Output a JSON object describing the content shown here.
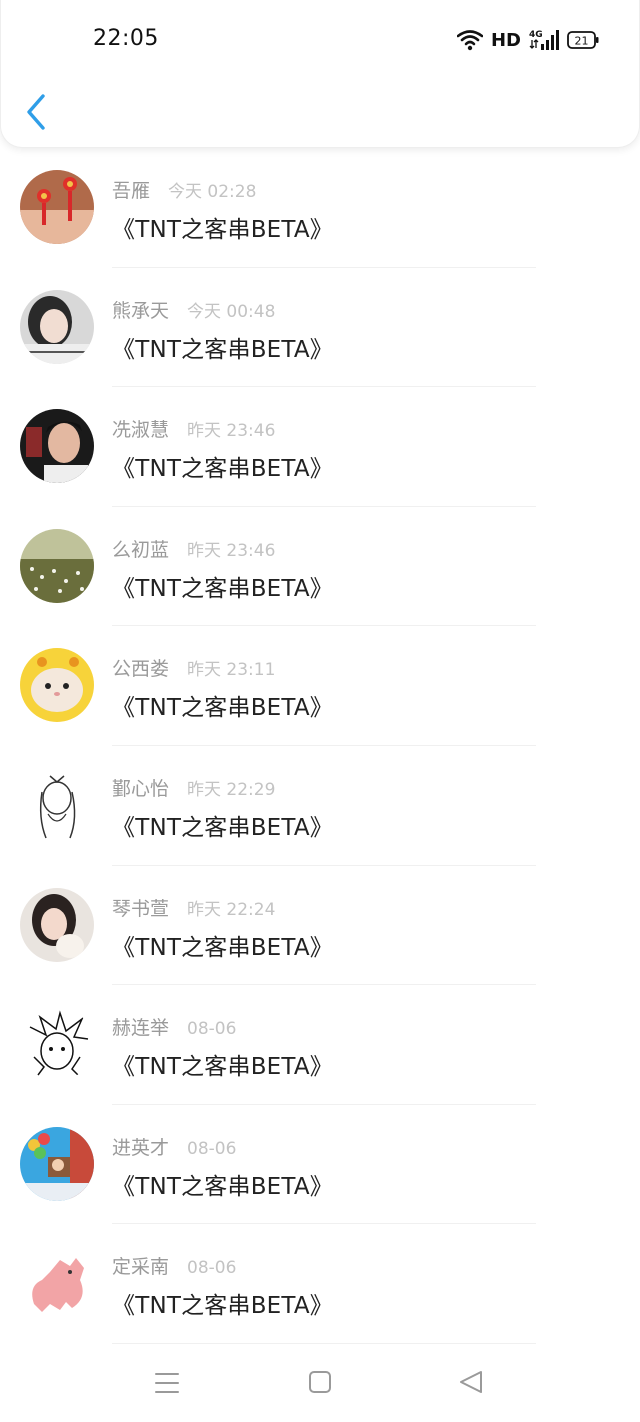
{
  "status_bar": {
    "time": "22:05",
    "hd": "HD",
    "network": "4G",
    "battery": "21"
  },
  "header": {
    "back_icon": "chevron-left-icon",
    "accent": "#2f9ee8"
  },
  "messages": [
    {
      "name": "吾雁",
      "time": "今天 02:28",
      "text": "《TNT之客串BETA》"
    },
    {
      "name": "熊承天",
      "time": "今天 00:48",
      "text": "《TNT之客串BETA》"
    },
    {
      "name": "冼淑慧",
      "time": "昨天 23:46",
      "text": "《TNT之客串BETA》"
    },
    {
      "name": "么初蓝",
      "time": "昨天 23:46",
      "text": "《TNT之客串BETA》"
    },
    {
      "name": "公西娄",
      "time": "昨天 23:11",
      "text": "《TNT之客串BETA》"
    },
    {
      "name": "鄞心怡",
      "time": "昨天 22:29",
      "text": "《TNT之客串BETA》"
    },
    {
      "name": "琴书萱",
      "time": "昨天 22:24",
      "text": "《TNT之客串BETA》"
    },
    {
      "name": "赫连举",
      "time": "08-06",
      "text": "《TNT之客串BETA》"
    },
    {
      "name": "进英才",
      "time": "08-06",
      "text": "《TNT之客串BETA》"
    },
    {
      "name": "定采南",
      "time": "08-06",
      "text": "《TNT之客串BETA》"
    }
  ],
  "navigation_bar": {
    "menu_icon": "menu-icon",
    "home_icon": "square-home-icon",
    "back_icon": "triangle-back-icon"
  }
}
